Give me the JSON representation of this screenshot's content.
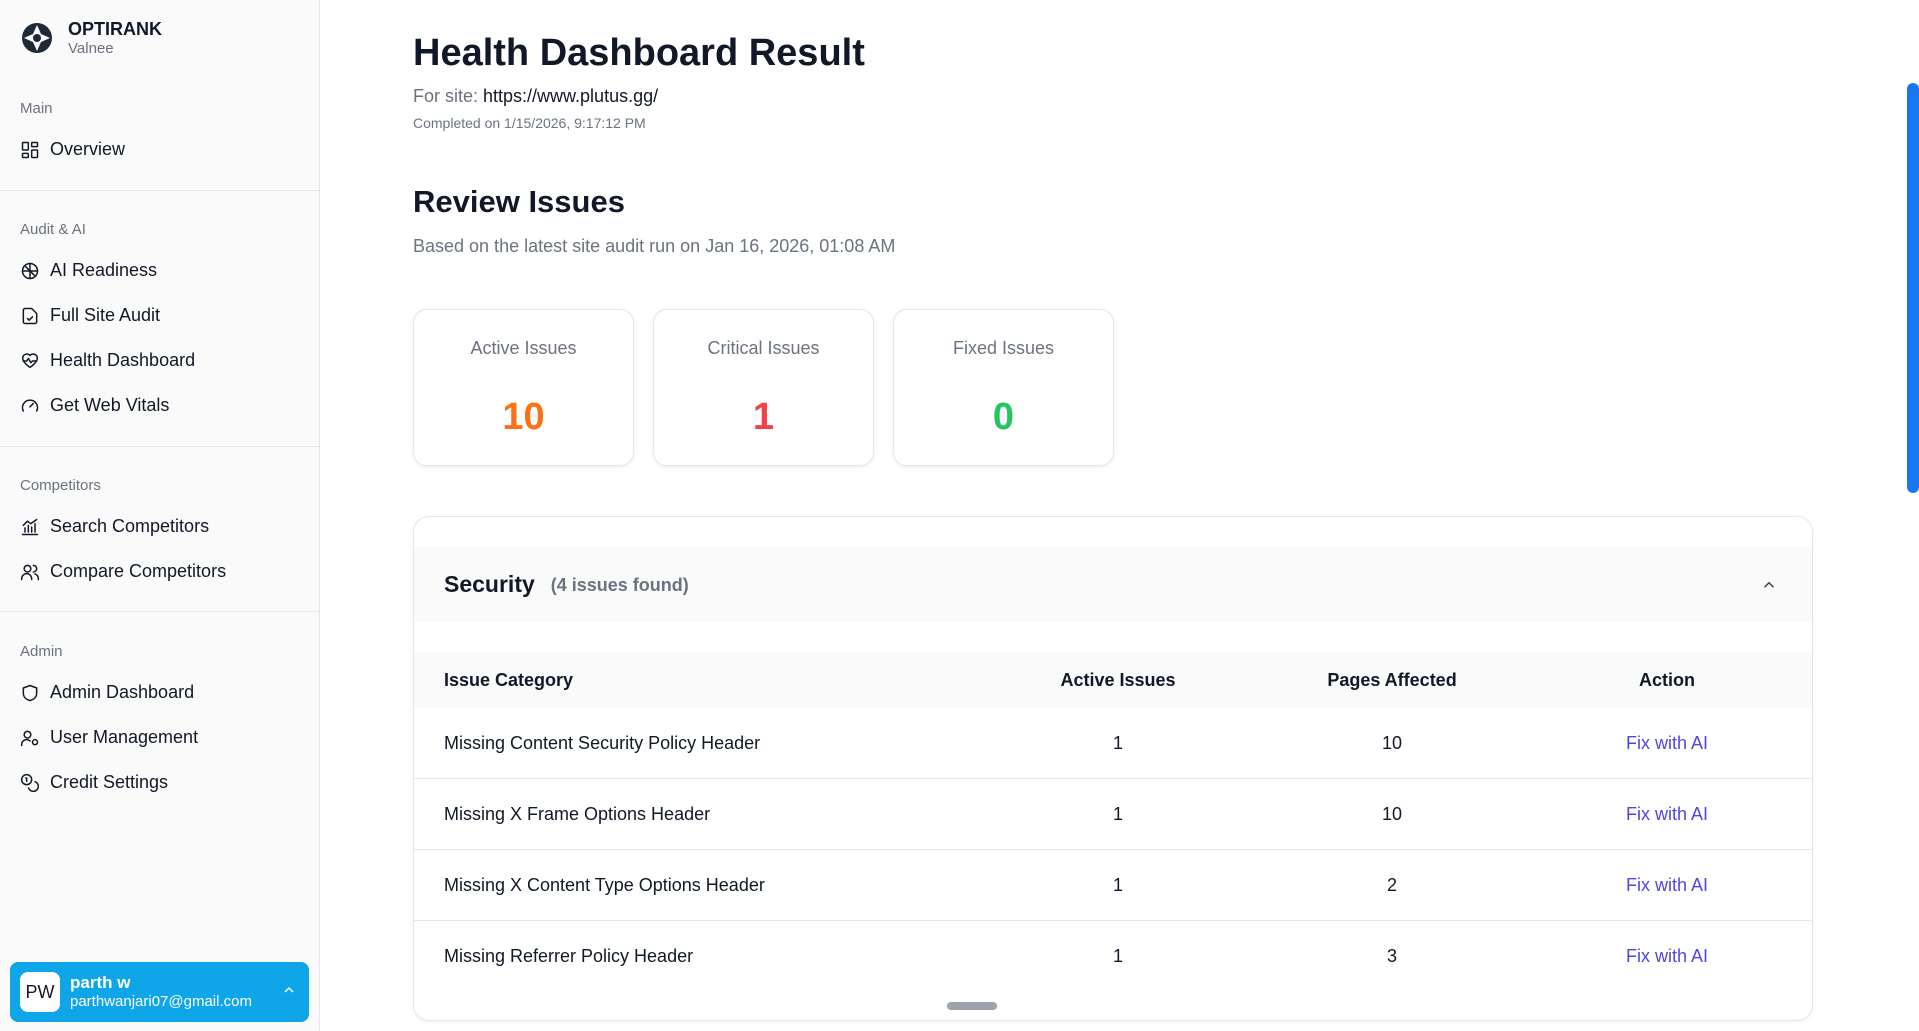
{
  "sidebar": {
    "brand": {
      "name": "OPTIRANK",
      "sub": "Valnee"
    },
    "sections": [
      {
        "title": "Main",
        "items": [
          {
            "label": "Overview",
            "icon": "layout-grid-icon"
          }
        ]
      },
      {
        "title": "Audit & AI",
        "items": [
          {
            "label": "AI Readiness",
            "icon": "brain-icon"
          },
          {
            "label": "Full Site Audit",
            "icon": "file-check-icon"
          },
          {
            "label": "Health Dashboard",
            "icon": "heart-pulse-icon"
          },
          {
            "label": "Get Web Vitals",
            "icon": "gauge-icon"
          }
        ]
      },
      {
        "title": "Competitors",
        "items": [
          {
            "label": "Search Competitors",
            "icon": "chart-bar-icon"
          },
          {
            "label": "Compare Competitors",
            "icon": "users-icon"
          }
        ]
      },
      {
        "title": "Admin",
        "items": [
          {
            "label": "Admin Dashboard",
            "icon": "shield-icon"
          },
          {
            "label": "User Management",
            "icon": "user-cog-icon"
          },
          {
            "label": "Credit Settings",
            "icon": "coins-icon"
          }
        ]
      }
    ],
    "user": {
      "initials": "PW",
      "name": "parth w",
      "email": "parthwanjari07@gmail.com"
    }
  },
  "header": {
    "title": "Health Dashboard Result",
    "site_prefix": "For site: ",
    "site_url": "https://www.plutus.gg/",
    "completed": "Completed on 1/15/2026, 9:17:12 PM"
  },
  "review": {
    "title": "Review Issues",
    "subtitle": "Based on the latest site audit run on Jan 16, 2026, 01:08 AM"
  },
  "stats": [
    {
      "label": "Active Issues",
      "value": "10",
      "color": "#f97316"
    },
    {
      "label": "Critical Issues",
      "value": "1",
      "color": "#ef4444"
    },
    {
      "label": "Fixed Issues",
      "value": "0",
      "color": "#22c55e"
    }
  ],
  "panel": {
    "title": "Security",
    "count": "(4 issues found)",
    "columns": [
      "Issue Category",
      "Active Issues",
      "Pages Affected",
      "Action"
    ],
    "rows": [
      {
        "category": "Missing Content Security Policy Header",
        "active": "1",
        "pages": "10",
        "action": "Fix with AI"
      },
      {
        "category": "Missing X Frame Options Header",
        "active": "1",
        "pages": "10",
        "action": "Fix with AI"
      },
      {
        "category": "Missing X Content Type Options Header",
        "active": "1",
        "pages": "2",
        "action": "Fix with AI"
      },
      {
        "category": "Missing Referrer Policy Header",
        "active": "1",
        "pages": "3",
        "action": "Fix with AI"
      }
    ]
  }
}
